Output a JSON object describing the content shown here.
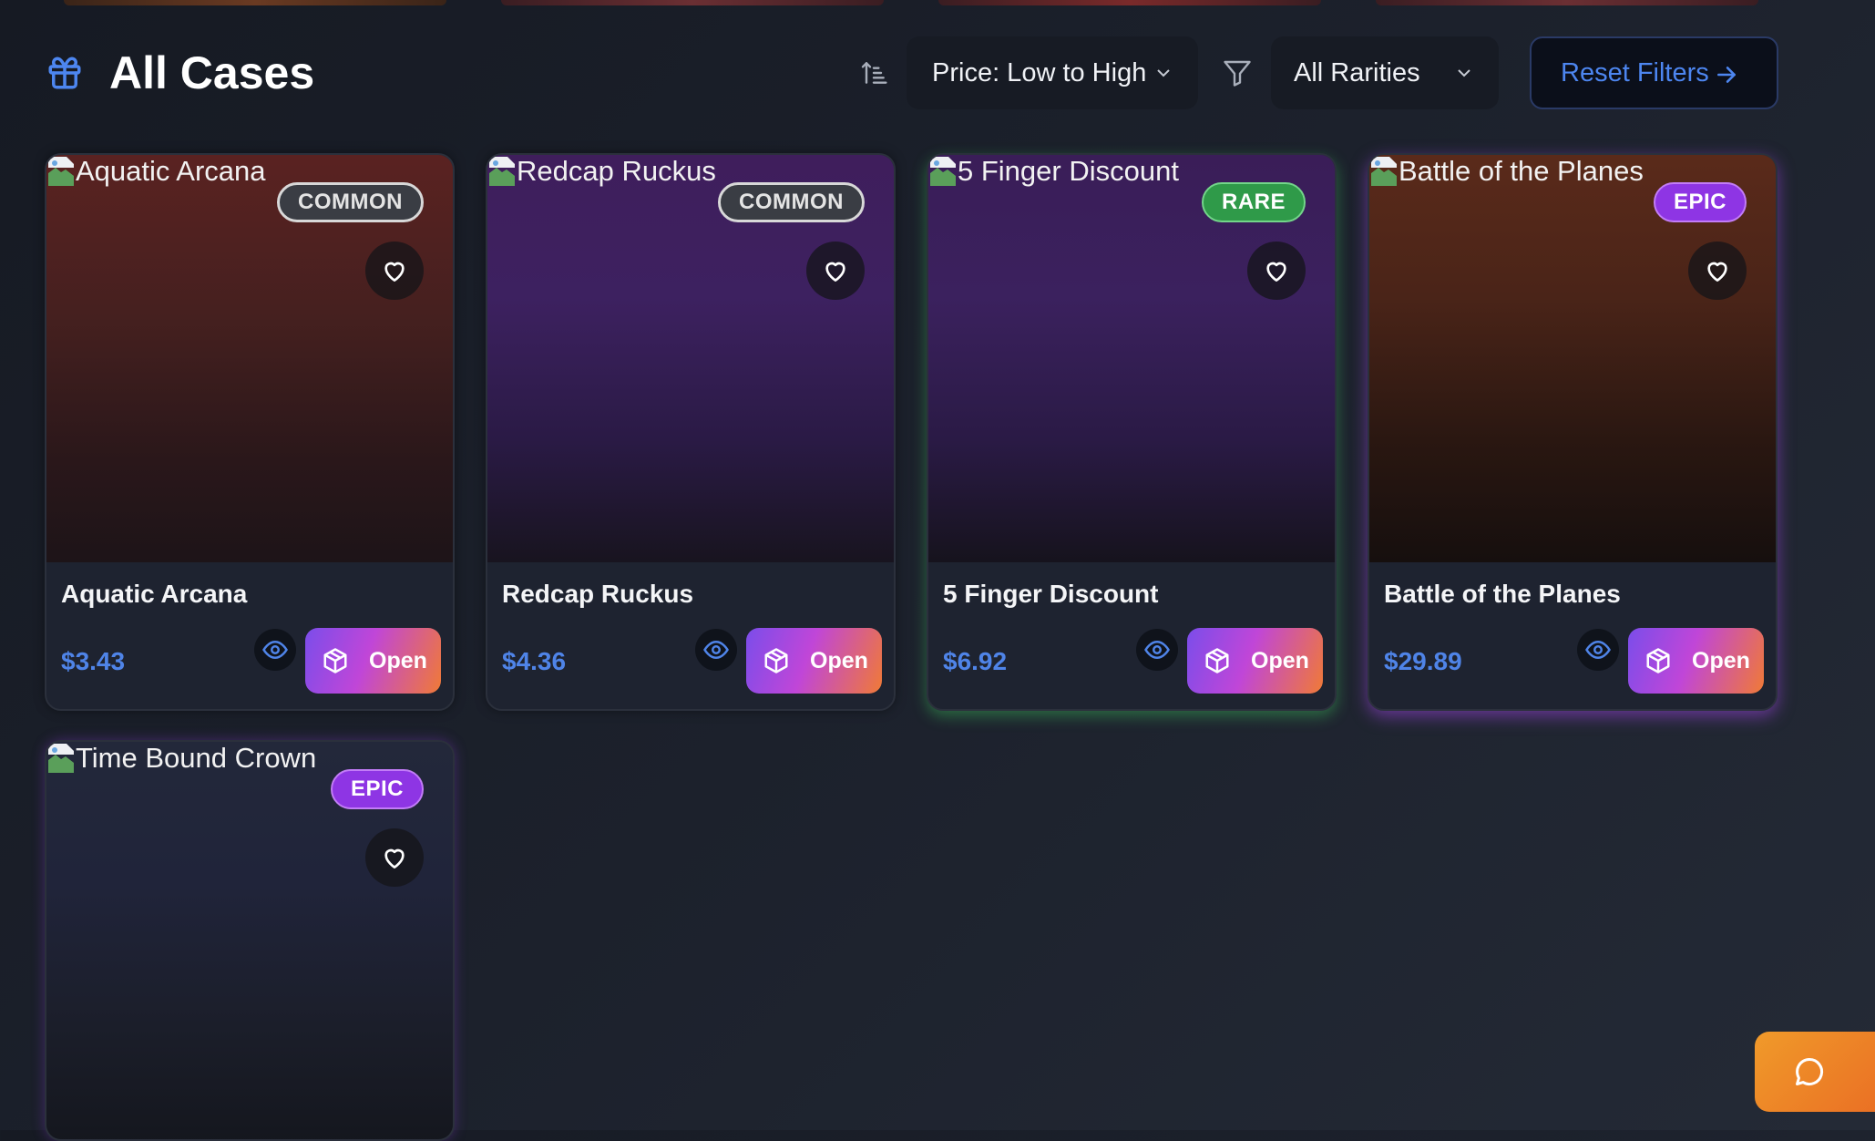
{
  "header": {
    "title": "All Cases",
    "sort_label": "Price: Low to High",
    "rarity_label": "All Rarities",
    "reset_label": "Reset Filters"
  },
  "cards": [
    {
      "image_alt": "Aquatic Arcana",
      "name": "Aquatic Arcana",
      "rarity": "COMMON",
      "price": "$3.43",
      "open_label": "Open"
    },
    {
      "image_alt": "Redcap Ruckus",
      "name": "Redcap Ruckus",
      "rarity": "COMMON",
      "price": "$4.36",
      "open_label": "Open"
    },
    {
      "image_alt": "5 Finger Discount",
      "name": "5 Finger Discount",
      "rarity": "RARE",
      "price": "$6.92",
      "open_label": "Open"
    },
    {
      "image_alt": "Battle of the Planes",
      "name": "Battle of the Planes",
      "rarity": "EPIC",
      "price": "$29.89",
      "open_label": "Open"
    },
    {
      "image_alt": "Time Bound Crown",
      "rarity": "EPIC"
    }
  ],
  "colors": {
    "accent_blue": "#4f84e8",
    "common": "#3a3d44",
    "rare": "#2f9a49",
    "epic": "#8e35e4",
    "chat": "#ea6f24"
  },
  "icons": [
    "gift-icon",
    "sort-ascending-icon",
    "chevron-down-icon",
    "filter-icon",
    "arrow-right-icon",
    "heart-icon",
    "eye-icon",
    "box-icon",
    "chat-icon",
    "broken-image-icon"
  ]
}
